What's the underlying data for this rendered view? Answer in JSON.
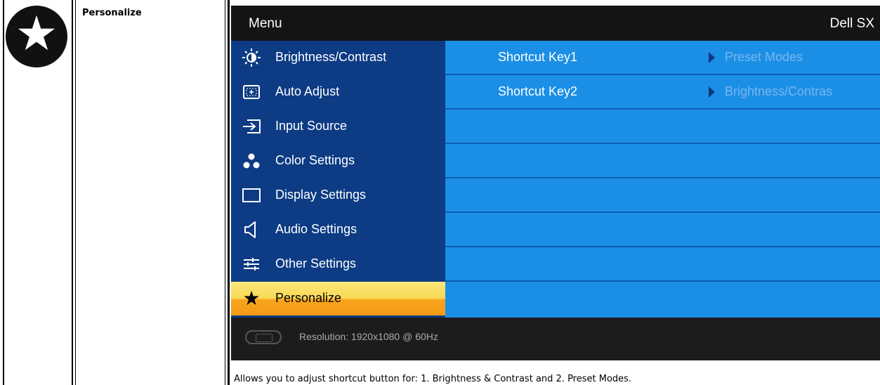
{
  "section": {
    "title": "Personalize",
    "icon": "star-icon"
  },
  "osd": {
    "title": "Menu",
    "model": "Dell SX",
    "menu_items": [
      {
        "label": "Brightness/Contrast",
        "icon": "brightness-icon"
      },
      {
        "label": "Auto Adjust",
        "icon": "auto-adjust-icon"
      },
      {
        "label": "Input Source",
        "icon": "input-source-icon"
      },
      {
        "label": "Color Settings",
        "icon": "color-settings-icon"
      },
      {
        "label": "Display Settings",
        "icon": "display-settings-icon"
      },
      {
        "label": "Audio Settings",
        "icon": "speaker-icon"
      },
      {
        "label": "Other Settings",
        "icon": "sliders-icon"
      },
      {
        "label": "Personalize",
        "icon": "star-icon",
        "selected": true
      }
    ],
    "options": [
      {
        "key": "Shortcut Key1",
        "value": "Preset Modes"
      },
      {
        "key": "Shortcut Key2",
        "value": "Brightness/Contras"
      }
    ],
    "footer": {
      "connector_icon": "vga-connector-icon",
      "resolution": "Resolution: 1920x1080 @ 60Hz"
    }
  },
  "description": "Allows you to adjust shortcut button for: 1. Brightness & Contrast and 2. Preset Modes.",
  "colors": {
    "menu_bg": "#0d3b84",
    "option_bg": "#1b8fe6",
    "selected_gradient_top": "#fbe77a",
    "selected_gradient_bottom": "#f59a16",
    "option_value_text": "#79b6ef"
  }
}
